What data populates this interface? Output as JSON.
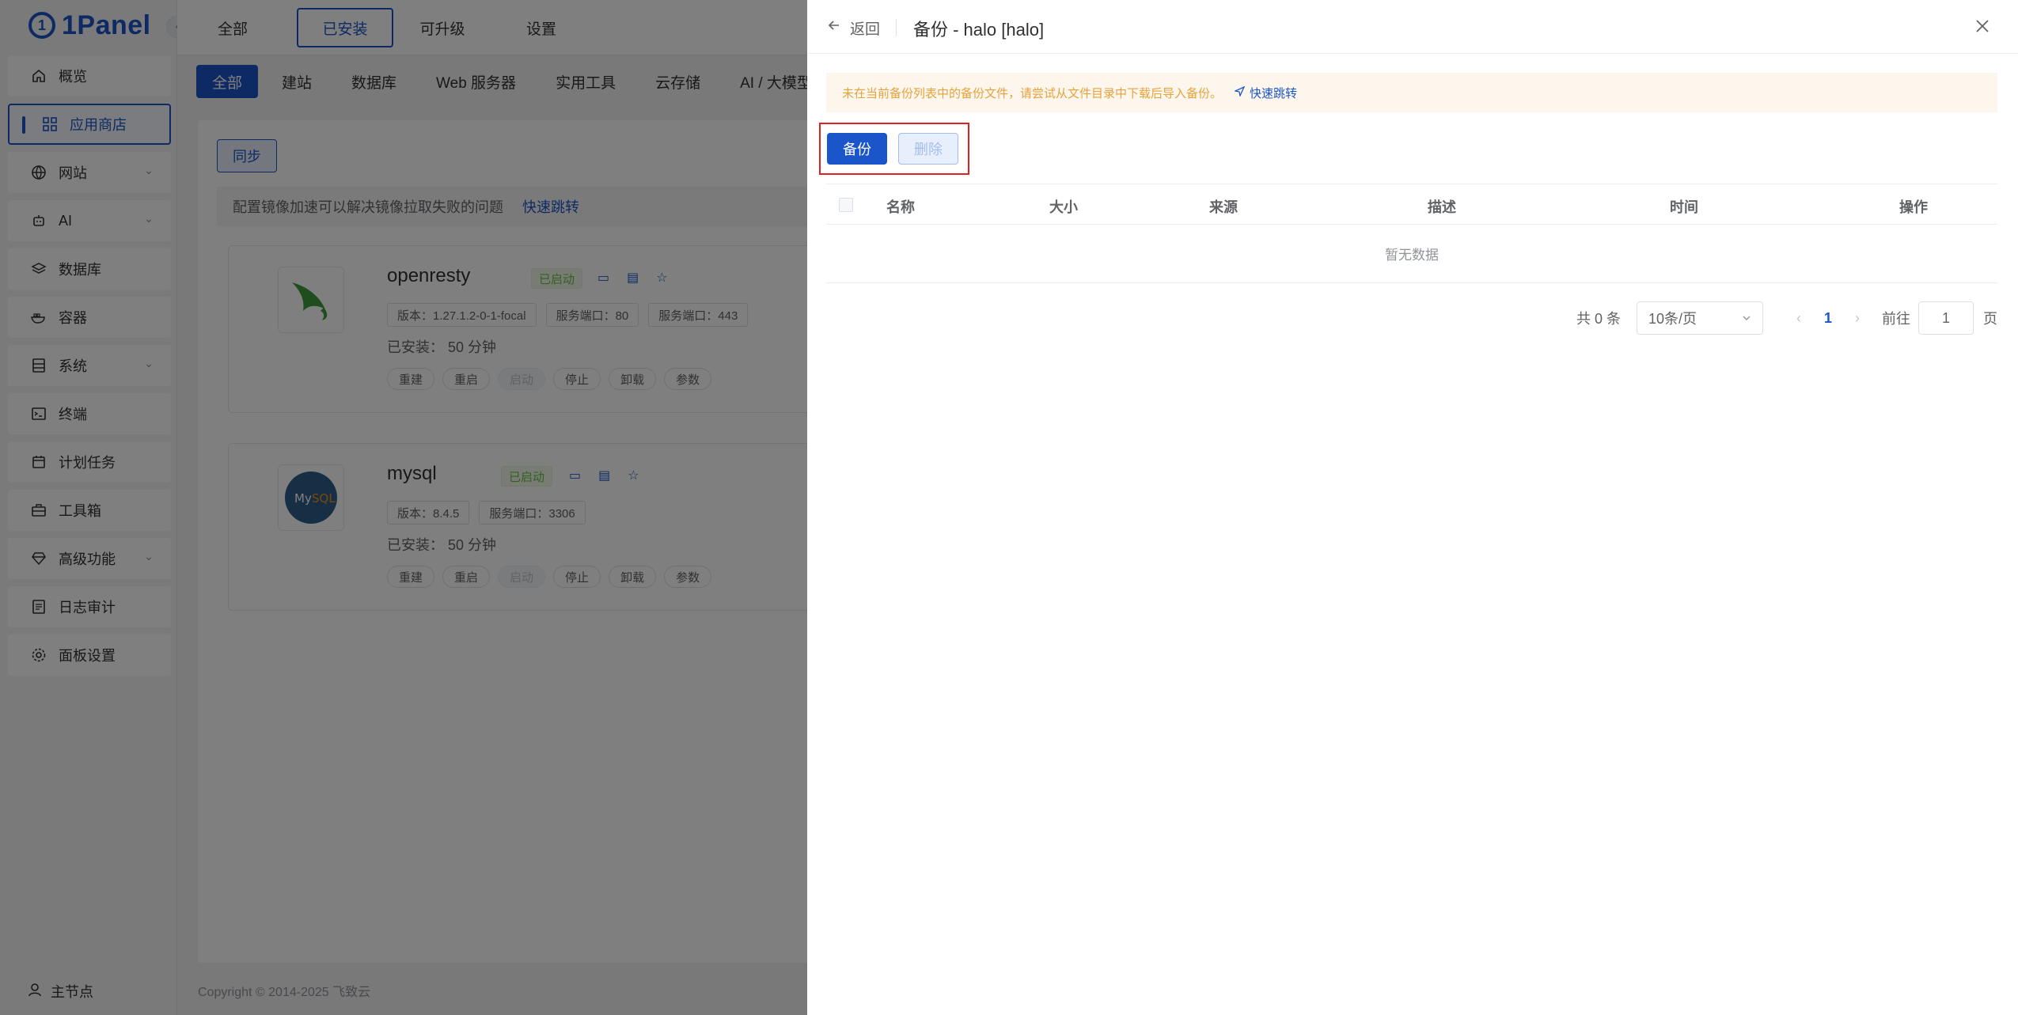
{
  "brand": {
    "name": "1Panel",
    "mark": "1"
  },
  "sidebar": {
    "items": [
      {
        "label": "概览",
        "icon": "home-icon"
      },
      {
        "label": "应用商店",
        "icon": "grid-icon"
      },
      {
        "label": "网站",
        "icon": "globe-icon"
      },
      {
        "label": "AI",
        "icon": "robot-icon"
      },
      {
        "label": "数据库",
        "icon": "layers-icon"
      },
      {
        "label": "容器",
        "icon": "docker-icon"
      },
      {
        "label": "系统",
        "icon": "server-icon"
      },
      {
        "label": "终端",
        "icon": "terminal-icon"
      },
      {
        "label": "计划任务",
        "icon": "calendar-icon"
      },
      {
        "label": "工具箱",
        "icon": "toolbox-icon"
      },
      {
        "label": "高级功能",
        "icon": "diamond-icon"
      },
      {
        "label": "日志审计",
        "icon": "log-icon"
      },
      {
        "label": "面板设置",
        "icon": "gear-icon"
      }
    ],
    "node_label": "主节点"
  },
  "topbar": {
    "tabs": [
      "全部",
      "已安装",
      "可升级",
      "设置"
    ],
    "active_tab": "已安装"
  },
  "categories": [
    "全部",
    "建站",
    "数据库",
    "Web 服务器",
    "实用工具",
    "云存储",
    "AI / 大模型"
  ],
  "sync_label": "同步",
  "mirror_tip": {
    "text": "配置镜像加速可以解决镜像拉取失败的问题",
    "link": "快速跳转"
  },
  "apps": [
    {
      "name": "openresty",
      "status": "已启动",
      "tags": [
        "版本：1.27.1.2-0-1-focal",
        "服务端口：80",
        "服务端口：443"
      ],
      "installed": "已安装：  50 分钟",
      "buttons": [
        "重建",
        "重启",
        "启动",
        "停止",
        "卸载",
        "参数"
      ]
    },
    {
      "name": "mysql",
      "status": "已启动",
      "tags": [
        "版本：8.4.5",
        "服务端口：3306"
      ],
      "installed": "已安装：  50 分钟",
      "buttons": [
        "重建",
        "重启",
        "启动",
        "停止",
        "卸载",
        "参数"
      ]
    }
  ],
  "footer": "Copyright © 2014-2025 飞致云",
  "drawer": {
    "back_label": "返回",
    "title": "备份 - halo [halo]",
    "alert": "未在当前备份列表中的备份文件，请尝试从文件目录中下载后导入备份。",
    "alert_link": "快速跳转",
    "backup_button": "备份",
    "delete_button": "删除",
    "columns": [
      "名称",
      "大小",
      "来源",
      "描述",
      "时间",
      "操作"
    ],
    "empty_text": "暂无数据",
    "pager": {
      "total": "共 0 条",
      "page_size": "10条/页",
      "current_page": "1",
      "goto_label": "前往",
      "goto_value": "1",
      "page_suffix": "页"
    }
  },
  "colors": {
    "primary": "#1a55c9",
    "highlight": "#e02020",
    "warning": "#e6a23c",
    "success": "#67c23a"
  }
}
